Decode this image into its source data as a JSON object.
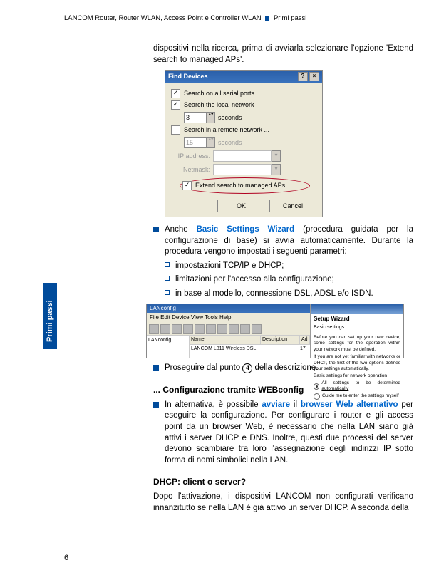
{
  "header": {
    "left": "LANCOM Router, Router WLAN, Access Point e Controller WLAN",
    "right": "Primi passi"
  },
  "side_tab": "Primi passi",
  "intro_para": "dispositivi nella ricerca, prima di avviarla selezionare l'opzione 'Extend search to managed APs'.",
  "find_devices": {
    "title": "Find Devices",
    "opt_serial": "Search on all serial ports",
    "opt_local": "Search the local network",
    "seconds_value": "3",
    "seconds_label": "seconds",
    "opt_remote": "Search in a remote network ...",
    "seconds2_value": "15",
    "seconds2_label": "seconds",
    "lbl_ip": "IP address:",
    "lbl_mask": "Netmask:",
    "opt_extend": "Extend search to managed APs",
    "btn_ok": "OK",
    "btn_cancel": "Cancel"
  },
  "bullet_basic": {
    "prefix": "Anche ",
    "link": "Basic Settings Wizard",
    "rest": " (procedura guidata per la configurazione di base) si avvia automaticamente. Durante la procedura vengono impostati i seguenti parametri:"
  },
  "sub_bullets": [
    "impostazioni TCP/IP e DHCP;",
    "limitazioni per l'accesso alla configurazione;",
    "in base al modello, connessione DSL, ADSL e/o ISDN."
  ],
  "lanconfig": {
    "title": "LANconfig",
    "menubar": "File   Edit   Device   View   Tools   Help",
    "tree_root": "LANconfig",
    "col_name": "Name",
    "col_desc": "Description",
    "col_ad": "Ad",
    "row_name": "LANCOM L811 Wireless DSL",
    "row_ad": "17",
    "wiz_title": "Setup Wizard",
    "wiz_sub": "Basic settings",
    "wiz_text": "Before you can set up your new device, some settings for the operation within your network must be defined.",
    "wiz_text2": "If you are not yet familiar with networks or DHCP, the first of the two options defines your settings automatically.",
    "wiz_text3": "Basic settings for network operation",
    "wiz_radio1": "All settings to be determined automatically",
    "wiz_radio2": "Guide me to enter the settings myself"
  },
  "bullet_proseguire": {
    "prefix": "Proseguire dal punto ",
    "num": "4",
    "suffix": " della descrizione."
  },
  "h2_webconfig": "... Configurazione tramite WEBconfig",
  "bullet_web": {
    "p1": "In alternativa, è possibile ",
    "link1": "avviare",
    "p2": " il ",
    "link2": "browser Web alternativo",
    "p3": " per eseguire la configurazione. Per configurare i router e gli access point da un browser Web, è necessario che nella LAN siano già attivi i server DHCP e DNS. Inoltre, questi due processi del server devono scambiare tra loro l'assegnazione degli indirizzi IP sotto forma di nomi simbolici nella LAN."
  },
  "h2_dhcp": "DHCP: client o server?",
  "dhcp_para": "Dopo l'attivazione, i dispositivi LANCOM non configurati verificano innanzitutto se nella LAN è già attivo un server DHCP. A seconda della",
  "page_num": "6"
}
